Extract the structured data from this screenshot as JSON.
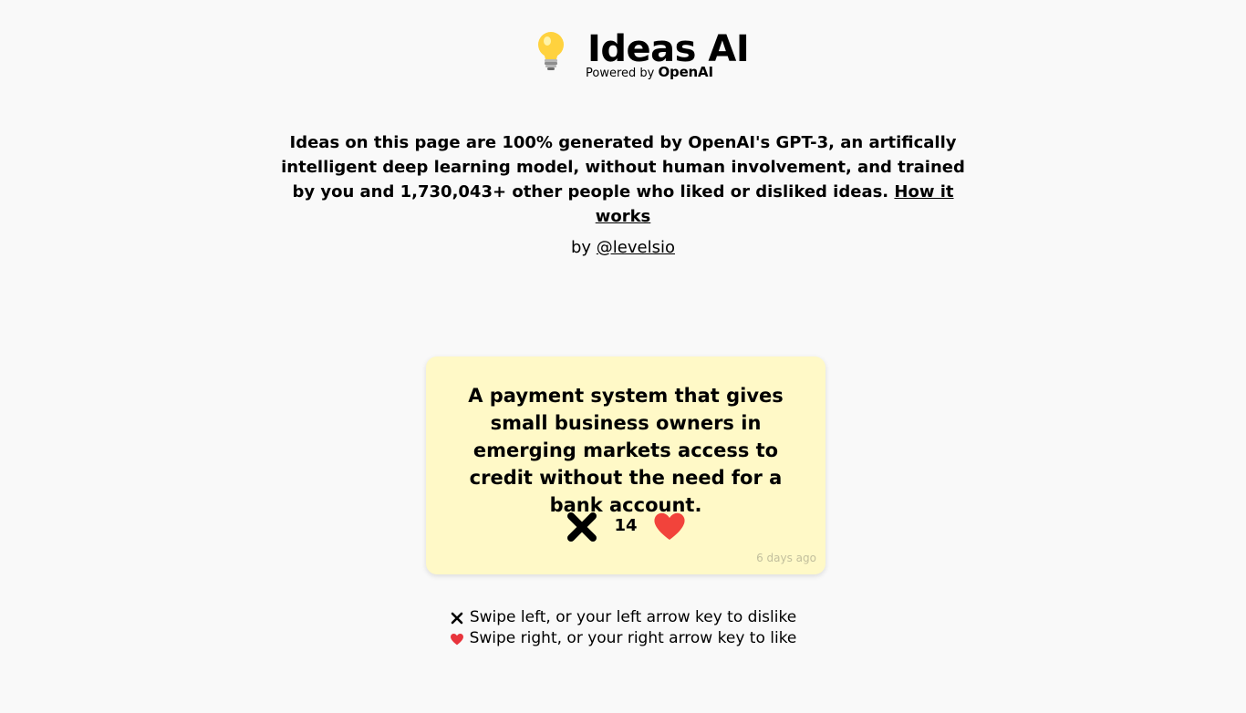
{
  "header": {
    "title": "Ideas AI",
    "powered_prefix": "Powered by",
    "powered_brand": "OpenAI"
  },
  "intro": {
    "text": "Ideas on this page are 100% generated by OpenAI's GPT-3, an artifically intelligent deep learning model, without human involvement, and trained by you and 1,730,043+ other people who liked or disliked ideas.",
    "link_label": "How it works"
  },
  "byline": {
    "prefix": "by",
    "author": "@levelsio"
  },
  "card": {
    "idea": "A payment system that gives small business owners in emerging markets access to credit without the need for a bank account.",
    "like_count": "14",
    "timestamp": "6 days ago",
    "dislike_icon": "cross-icon",
    "like_icon": "heart-icon",
    "background": "#fff9c7",
    "heart_color": "#f2433b"
  },
  "hints": {
    "dislike": "Swipe left, or your left arrow key to dislike",
    "like": "Swipe right, or your right arrow key to like"
  }
}
